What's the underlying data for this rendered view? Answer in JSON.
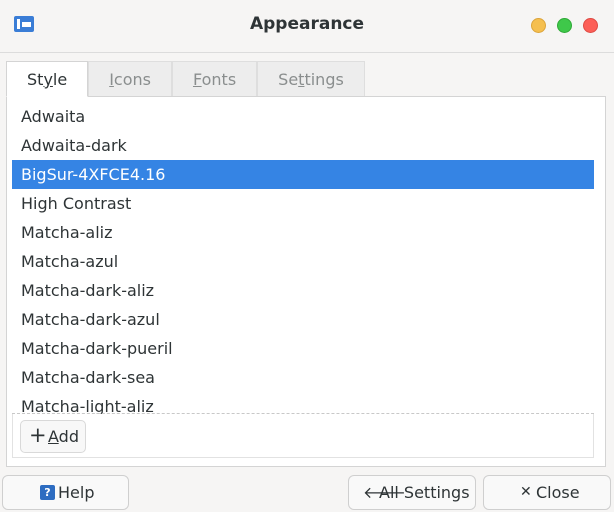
{
  "window": {
    "title": "Appearance",
    "app_icon": "appearance-app-icon",
    "buttons": [
      "minimize",
      "maximize",
      "close"
    ]
  },
  "tabs": [
    {
      "label_prefix": "",
      "mnemonic": "S",
      "label_rest": "tyle",
      "active": true,
      "display": "Style",
      "underline_char": "y"
    },
    {
      "label": "Icons",
      "underline_char": "I"
    },
    {
      "label": "Fonts",
      "underline_char": "F"
    },
    {
      "label": "Settings",
      "underline_char": "t"
    }
  ],
  "themes": {
    "items": [
      "Adwaita",
      "Adwaita-dark",
      "BigSur-4XFCE4.16",
      "High Contrast",
      "Matcha-aliz",
      "Matcha-azul",
      "Matcha-dark-aliz",
      "Matcha-dark-azul",
      "Matcha-dark-pueril",
      "Matcha-dark-sea",
      "Matcha-light-aliz"
    ],
    "selected": "BigSur-4XFCE4.16"
  },
  "add_button": {
    "label": "Add",
    "icon": "plus-icon"
  },
  "footer": {
    "help_label": "Help",
    "all_settings_label": "All Settings",
    "close_label": "Close"
  },
  "colors": {
    "selection": "#3584e4",
    "minimize": "#f5bf4f",
    "maximize": "#3fc84a",
    "close": "#fc5f57"
  }
}
